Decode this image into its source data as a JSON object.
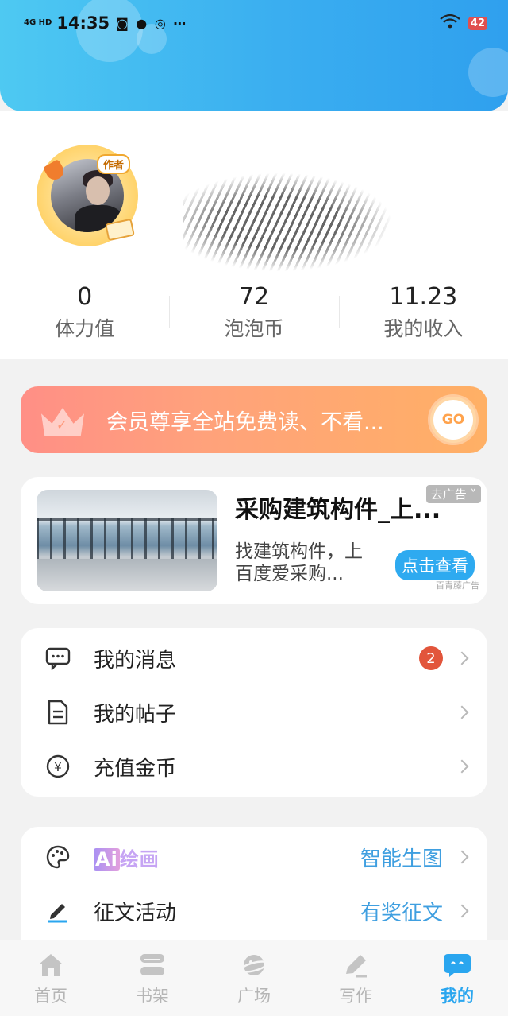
{
  "status_bar": {
    "network": "4G HD",
    "time": "14:35",
    "battery": "42"
  },
  "profile": {
    "author_tag": "作者",
    "stats": [
      {
        "value": "0",
        "label": "体力值"
      },
      {
        "value": "72",
        "label": "泡泡币"
      },
      {
        "value": "11.23",
        "label": "我的收入"
      }
    ]
  },
  "vip_banner": {
    "text": "会员尊享全站免费读、不看...",
    "go_label": "GO"
  },
  "ad": {
    "title": "采购建筑构件_上...",
    "description": "找建筑构件，上百度爱采购...",
    "close_label": "去广告",
    "button_label": "点击查看",
    "source": "百青藤广告"
  },
  "menu_group_1": [
    {
      "label": "我的消息",
      "badge": "2",
      "icon": "message-icon"
    },
    {
      "label": "我的帖子",
      "icon": "document-icon"
    },
    {
      "label": "充值金币",
      "icon": "coin-icon"
    }
  ],
  "menu_group_2": [
    {
      "label_prefix": "Ai",
      "label_suffix": "绘画",
      "extra": "智能生图",
      "icon": "palette-icon"
    },
    {
      "label": "征文活动",
      "extra": "有奖征文",
      "icon": "pen-icon"
    }
  ],
  "tabs": [
    {
      "label": "首页",
      "icon": "home-icon",
      "active": false
    },
    {
      "label": "书架",
      "icon": "bookshelf-icon",
      "active": false
    },
    {
      "label": "广场",
      "icon": "planet-icon",
      "active": false
    },
    {
      "label": "写作",
      "icon": "write-icon",
      "active": false
    },
    {
      "label": "我的",
      "icon": "profile-bubble-icon",
      "active": true
    }
  ],
  "colors": {
    "accent": "#2aa6ef",
    "badge": "#e2553b",
    "vip_start": "#ff8f86",
    "vip_end": "#ffb065"
  }
}
